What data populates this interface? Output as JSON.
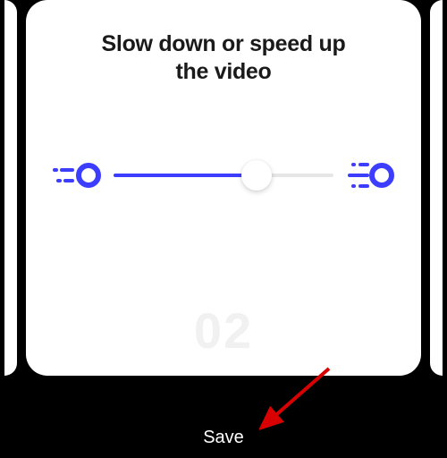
{
  "card": {
    "title": "Slow down or speed up\nthe video",
    "slide_number": "02"
  },
  "slider": {
    "fill_percent": 65,
    "thumb_percent": 65
  },
  "colors": {
    "accent": "#3d3dff",
    "arrow": "#d80000"
  },
  "bottom": {
    "save_label": "Save"
  }
}
